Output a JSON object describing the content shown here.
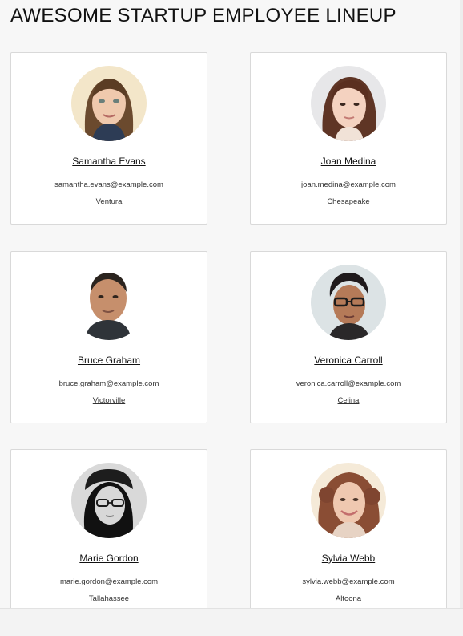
{
  "page": {
    "title": "AWESOME STARTUP EMPLOYEE LINEUP"
  },
  "employees": [
    {
      "name": "Samantha Evans",
      "email": "samantha.evans@example.com",
      "city": "Ventura"
    },
    {
      "name": "Joan Medina",
      "email": "joan.medina@example.com",
      "city": "Chesapeake"
    },
    {
      "name": "Bruce Graham",
      "email": "bruce.graham@example.com",
      "city": "Victorville"
    },
    {
      "name": "Veronica Carroll",
      "email": "veronica.carroll@example.com",
      "city": "Celina"
    },
    {
      "name": "Marie Gordon",
      "email": "marie.gordon@example.com",
      "city": "Tallahassee"
    },
    {
      "name": "Sylvia Webb",
      "email": "sylvia.webb@example.com",
      "city": "Altoona"
    }
  ]
}
